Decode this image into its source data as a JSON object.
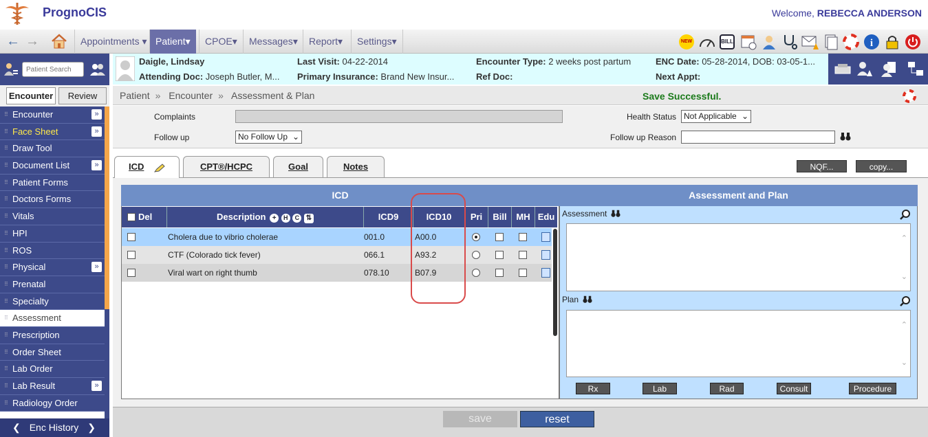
{
  "app": {
    "title": "PrognoCIS",
    "welcome_prefix": "Welcome,",
    "user": "REBECCA ANDERSON"
  },
  "nav": {
    "menus": [
      "Appointments",
      "Patient",
      "CPOE",
      "Messages",
      "Report",
      "Settings"
    ],
    "active": "Patient",
    "toolbar_icons": [
      "new-badge-icon",
      "dashboard-icon",
      "bill-icon",
      "calendar-icon",
      "user-icon",
      "stethoscope-icon",
      "alert-mail-icon",
      "documents-icon",
      "lifebuoy-icon",
      "info-icon",
      "lock-icon",
      "power-icon"
    ]
  },
  "sidebar": {
    "search_placeholder": "Patient Search",
    "tabs": [
      "Encounter",
      "Review"
    ],
    "items": [
      {
        "label": "Encounter",
        "expand": "»"
      },
      {
        "label": "Face Sheet",
        "expand": "»",
        "highlight": true
      },
      {
        "label": "Draw Tool"
      },
      {
        "label": "Document List",
        "expand": "»"
      },
      {
        "label": "Patient Forms"
      },
      {
        "label": "Doctors Forms"
      },
      {
        "label": "Vitals"
      },
      {
        "label": "HPI"
      },
      {
        "label": "ROS"
      },
      {
        "label": "Physical",
        "expand": "»"
      },
      {
        "label": "Prenatal"
      },
      {
        "label": "Specialty"
      },
      {
        "label": "Assessment",
        "active": true
      },
      {
        "label": "Prescription"
      },
      {
        "label": "Order Sheet"
      },
      {
        "label": "Lab Order"
      },
      {
        "label": "Lab Result",
        "expand": "»"
      },
      {
        "label": "Radiology Order"
      }
    ],
    "enc_history": "Enc History"
  },
  "patient": {
    "name": "Daigle, Lindsay",
    "attending_label": "Attending Doc:",
    "attending": "Joseph Butler, M...",
    "last_visit_label": "Last Visit:",
    "last_visit": "04-22-2014",
    "insurance_label": "Primary Insurance:",
    "insurance": "Brand New Insur...",
    "enc_type_label": "Encounter Type:",
    "enc_type": "2 weeks post partum",
    "ref_doc_label": "Ref Doc:",
    "enc_date_label": "ENC Date:",
    "enc_date": "05-28-2014, DOB: 03-05-1...",
    "next_appt_label": "Next Appt:"
  },
  "breadcrumb": [
    "Patient",
    "Encounter",
    "Assessment & Plan"
  ],
  "breadcrumb_sep": "»",
  "status_message": "Save Successful.",
  "form": {
    "complaints_label": "Complaints",
    "followup_label": "Follow up",
    "followup_value": "No Follow Up",
    "health_status_label": "Health Status",
    "health_status_value": "Not Applicable",
    "followup_reason_label": "Follow up Reason",
    "followup_reason_value": ""
  },
  "tabs": [
    "ICD",
    "CPT®/HCPC",
    "Goal",
    "Notes"
  ],
  "tab_buttons": {
    "nqf": "NQF...",
    "copy": "copy..."
  },
  "icd": {
    "title": "ICD",
    "columns": {
      "del": "Del",
      "description": "Description",
      "icd9": "ICD9",
      "icd10": "ICD10",
      "pri": "Pri",
      "bill": "Bill",
      "mh": "MH",
      "edu": "Edu"
    },
    "desc_buttons": [
      "+",
      "H",
      "C",
      "⇅"
    ],
    "rows": [
      {
        "description": "Cholera due to vibrio cholerae",
        "icd9": "001.0",
        "icd10": "A00.0",
        "pri": true,
        "selected": true
      },
      {
        "description": "CTF (Colorado tick fever)",
        "icd9": "066.1",
        "icd10": "A93.2",
        "pri": false,
        "selected": false
      },
      {
        "description": "Viral wart on right thumb",
        "icd9": "078.10",
        "icd10": "B07.9",
        "pri": false,
        "selected": false
      }
    ]
  },
  "ap": {
    "title": "Assessment and Plan",
    "assessment_label": "Assessment",
    "plan_label": "Plan",
    "buttons": [
      "Rx",
      "Lab",
      "Rad",
      "Consult",
      "Procedure"
    ]
  },
  "actions": {
    "save": "save",
    "reset": "reset"
  },
  "colors": {
    "nav_blue": "#3d4a8a",
    "header_blue": "#6f8fc7",
    "accent_orange": "#f5a64a",
    "success_green": "#1a7a1a",
    "highlight_red": "#d94a4a"
  }
}
